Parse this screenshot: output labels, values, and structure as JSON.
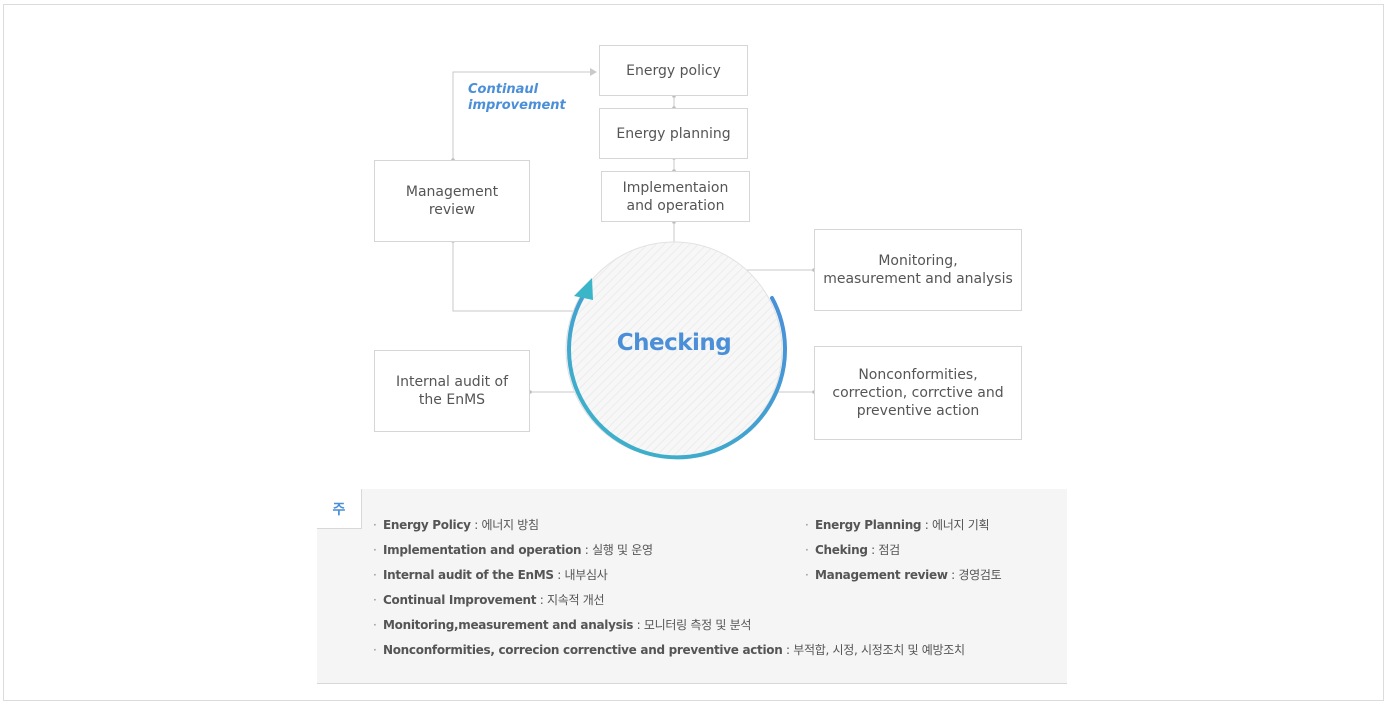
{
  "diagram": {
    "caption": "Continaul\nimprovement",
    "center_label": "Checking",
    "boxes": {
      "energy_policy": "Energy policy",
      "energy_planning": "Energy planning",
      "implementation": "Implementaion\nand operation",
      "management_review": "Management\nreview",
      "internal_audit": "Internal audit of\nthe EnMS",
      "monitoring": "Monitoring,\nmeasurement and analysis",
      "nonconformities": "Nonconformities,\ncorrection, corrctive and\npreventive action"
    },
    "colors": {
      "accent": "#4a8fd8",
      "arrow_start": "#3bb6c8",
      "arrow_end": "#4a8fd8"
    }
  },
  "legend": {
    "tag": "주",
    "left_items": [
      {
        "term": "Energy Policy",
        "sep": " : ",
        "desc": "에너지 방침"
      },
      {
        "term": "Implementation and operation",
        "sep": " : ",
        "desc": "실행 및 운영"
      },
      {
        "term": "Internal audit of the EnMS",
        "sep": " : ",
        "desc": "내부심사"
      },
      {
        "term": "Continual Improvement",
        "sep": " : ",
        "desc": "지속적 개선"
      },
      {
        "term": "Monitoring,measurement and analysis",
        "sep": " : ",
        "desc": "모니터링 측정 및 분석"
      },
      {
        "term": "Nonconformities, correcion correnctive and preventive action",
        "sep": " : ",
        "desc": "부적합, 시정, 시정조치 및 예방조치"
      }
    ],
    "right_items": [
      {
        "term": "Energy Planning",
        "sep": " : ",
        "desc": "에너지 기획"
      },
      {
        "term": "Cheking",
        "sep": " : ",
        "desc": "점검"
      },
      {
        "term": "Management review",
        "sep": " : ",
        "desc": "경영검토"
      }
    ]
  }
}
